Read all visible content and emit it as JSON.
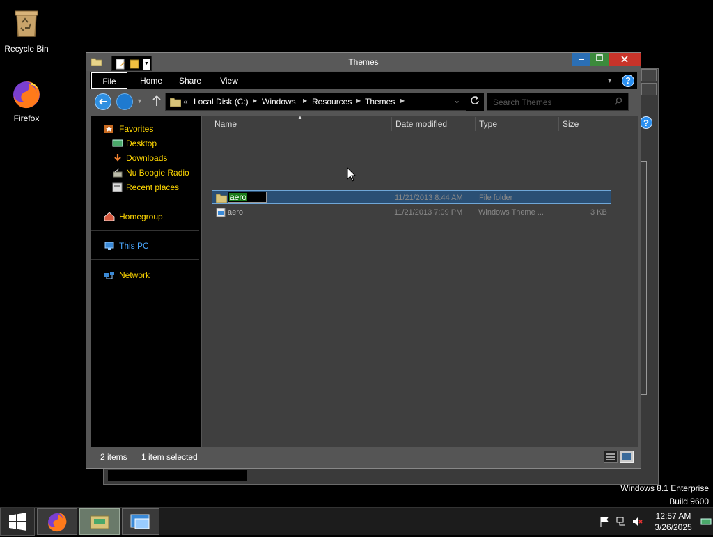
{
  "desktop": {
    "icons": [
      {
        "label": "Recycle Bin"
      },
      {
        "label": "Firefox"
      }
    ]
  },
  "window": {
    "title": "Themes",
    "ribbon_tabs": [
      "File",
      "Home",
      "Share",
      "View"
    ],
    "help_glyph": "?",
    "address": {
      "prefix": "«",
      "crumbs": [
        "Local Disk (C:)",
        "Windows",
        "Resources",
        "Themes"
      ]
    },
    "search_placeholder": "Search Themes",
    "nav": {
      "favorites": "Favorites",
      "favorites_items": [
        "Desktop",
        "Downloads",
        "Nu Boogie Radio",
        "Recent places"
      ],
      "homegroup": "Homegroup",
      "this_pc": "This PC",
      "network": "Network"
    },
    "columns": {
      "name": "Name",
      "date": "Date modified",
      "type": "Type",
      "size": "Size"
    },
    "rows": [
      {
        "name": "aero",
        "date": "11/21/2013 8:44 AM",
        "type": "File folder",
        "size": "",
        "renaming": true
      },
      {
        "name": "aero",
        "date": "11/21/2013 7:09 PM",
        "type": "Windows Theme ...",
        "size": "3 KB"
      }
    ],
    "status": {
      "count": "2 items",
      "selected": "1 item selected"
    }
  },
  "watermark": {
    "line1": "Windows 8.1 Enterprise",
    "line2": "Build 9600"
  },
  "clock": {
    "time": "12:57 AM",
    "date": "3/26/2025"
  },
  "colors": {
    "accent": "#2f8fe0",
    "nav_text": "#ffd700",
    "this_pc": "#4aa8ff",
    "selection": "#2a4f74",
    "rename_highlight": "#1a7a1a"
  }
}
